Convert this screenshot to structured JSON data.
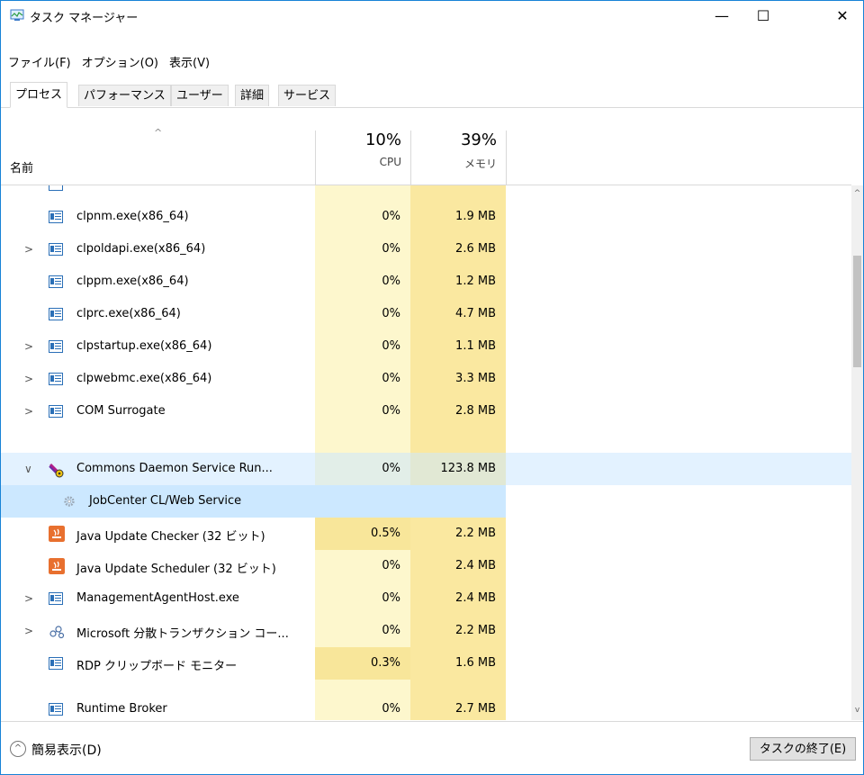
{
  "window": {
    "title": "タスク マネージャー",
    "minimize_glyph": "—",
    "maximize_glyph": "☐",
    "close_glyph": "✕"
  },
  "menu": [
    "ファイル(F)",
    "オプション(O)",
    "表示(V)"
  ],
  "tabs": [
    "プロセス",
    "パフォーマンス",
    "ユーザー",
    "詳細",
    "サービス"
  ],
  "active_tab": "プロセス",
  "header": {
    "sort_glyph": "^",
    "name_label": "名前",
    "cpu_percent": "10%",
    "cpu_label": "CPU",
    "mem_percent": "39%",
    "mem_label": "メモリ"
  },
  "rows": [
    {
      "name": "clpnm.exe(x86_64)",
      "cpu": "0%",
      "mem": "1.9 MB",
      "expand": "",
      "icon": "window-icon"
    },
    {
      "name": "clpoldapi.exe(x86_64)",
      "cpu": "0%",
      "mem": "2.6 MB",
      "expand": ">",
      "icon": "window-icon"
    },
    {
      "name": "clppm.exe(x86_64)",
      "cpu": "0%",
      "mem": "1.2 MB",
      "expand": "",
      "icon": "window-icon"
    },
    {
      "name": "clprc.exe(x86_64)",
      "cpu": "0%",
      "mem": "4.7 MB",
      "expand": "",
      "icon": "window-icon"
    },
    {
      "name": "clpstartup.exe(x86_64)",
      "cpu": "0%",
      "mem": "1.1 MB",
      "expand": ">",
      "icon": "window-icon"
    },
    {
      "name": "clpwebmc.exe(x86_64)",
      "cpu": "0%",
      "mem": "3.3 MB",
      "expand": ">",
      "icon": "window-icon"
    },
    {
      "name": "COM Surrogate",
      "cpu": "0%",
      "mem": "2.8 MB",
      "expand": ">",
      "icon": "window-icon"
    },
    {
      "name": "Commons Daemon Service Run...",
      "cpu": "0%",
      "mem": "123.8 MB",
      "expand": "∨",
      "icon": "daemon-icon"
    },
    {
      "name": "JobCenter CL/Web Service",
      "cpu": "",
      "mem": "",
      "expand": "",
      "icon": "gear-icon"
    },
    {
      "name": "Java Update Checker (32 ビット)",
      "cpu": "0.5%",
      "mem": "2.2 MB",
      "expand": "",
      "icon": "java-icon"
    },
    {
      "name": "Java Update Scheduler (32 ビット)",
      "cpu": "0%",
      "mem": "2.4 MB",
      "expand": "",
      "icon": "java-icon"
    },
    {
      "name": "ManagementAgentHost.exe",
      "cpu": "0%",
      "mem": "2.4 MB",
      "expand": ">",
      "icon": "window-icon"
    },
    {
      "name": "Microsoft 分散トランザクション コー...",
      "cpu": "0%",
      "mem": "2.2 MB",
      "expand": ">",
      "icon": "msdtc-icon"
    },
    {
      "name": "RDP クリップボード モニター",
      "cpu": "0.3%",
      "mem": "1.6 MB",
      "expand": "",
      "icon": "window-icon"
    },
    {
      "name": "Runtime Broker",
      "cpu": "0%",
      "mem": "2.7 MB",
      "expand": "",
      "icon": "window-icon"
    }
  ],
  "scroll": {
    "up_glyph": "^",
    "down_glyph": "v"
  },
  "footer": {
    "fewer_glyph": "^",
    "fewer_label": "簡易表示(D)",
    "end_task_label": "タスクの終了(E)"
  }
}
